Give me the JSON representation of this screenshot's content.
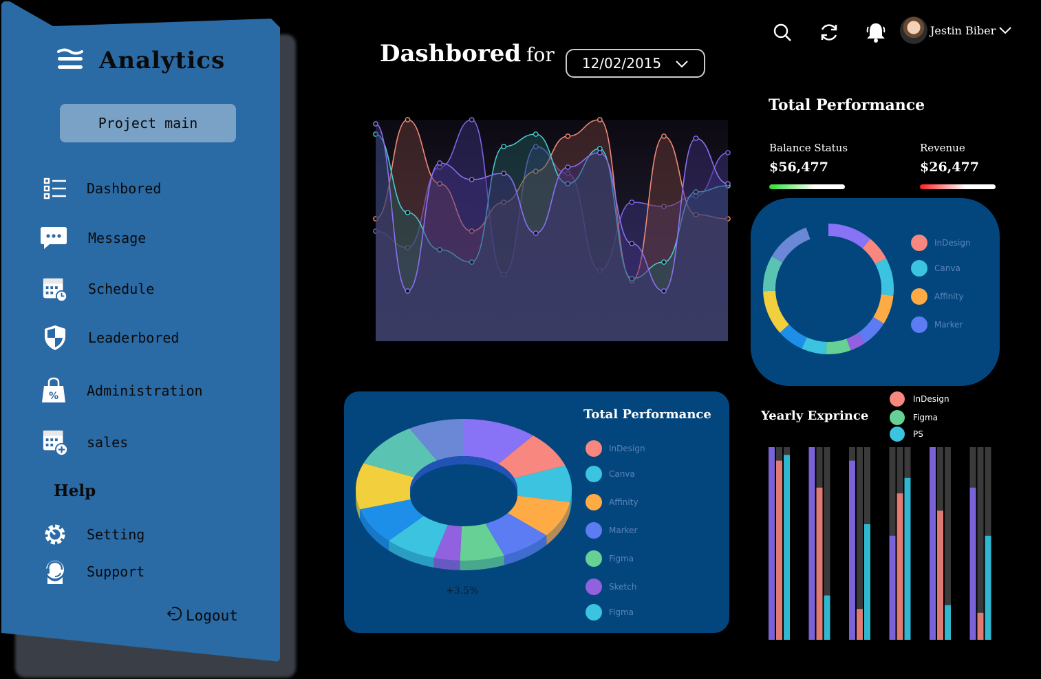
{
  "sidebar": {
    "brand": "Analytics",
    "project_button": "Project main",
    "items": [
      {
        "label": "Dashbored",
        "icon": "list-icon"
      },
      {
        "label": "Message",
        "icon": "message-icon"
      },
      {
        "label": "Schedule",
        "icon": "calendar-clock-icon"
      },
      {
        "label": "Leaderbored",
        "icon": "shield-icon"
      },
      {
        "label": "Administration",
        "icon": "shopping-bag-icon"
      },
      {
        "label": "sales",
        "icon": "calendar-plus-icon"
      }
    ],
    "help_heading": "Help",
    "help_items": [
      {
        "label": "Setting",
        "icon": "gear-icon"
      },
      {
        "label": "Support",
        "icon": "support-icon"
      }
    ],
    "logout": "Logout"
  },
  "header": {
    "title": "Dashbored",
    "title_suffix": "for",
    "date": "12/02/2015",
    "user_name": "Jestin Biber"
  },
  "summary": {
    "title": "Total Performance",
    "balance_label": "Balance Status",
    "balance_value": "$56,477",
    "revenue_label": "Revenue",
    "revenue_value": "$26,477"
  },
  "donut_legend": [
    "InDesign",
    "Canva",
    "Affinity",
    "Marker"
  ],
  "pie": {
    "title": "Total Performance",
    "note": "+3.5%",
    "legend": [
      "InDesign",
      "Canva",
      "Affinity",
      "Marker",
      "Figma",
      "Sketch",
      "Figma"
    ]
  },
  "yearly": {
    "title": "Yearly Exprince",
    "legend": [
      "InDesign",
      "Figma",
      "PS"
    ]
  },
  "colors": {
    "sidebar": "#2a6aa5",
    "card": "#03467e",
    "salmon": "#f8877f",
    "cyan": "#3bc3e0",
    "orange": "#ffab45",
    "blue": "#5b7cf2",
    "green": "#67d195",
    "purple": "#9161e0"
  },
  "chart_data": {
    "type": "area",
    "x": [
      0,
      1,
      2,
      3,
      4,
      5,
      6,
      7,
      8,
      9,
      10,
      11
    ],
    "series": [
      {
        "values": [
          46,
          38,
          77,
          100,
          25,
          87,
          74,
          27,
          60,
          58,
          63,
          84
        ]
      },
      {
        "values": [
          52,
          100,
          69,
          46,
          60,
          75,
          92,
          100,
          22,
          92,
          54,
          52
        ]
      },
      {
        "values": [
          93,
          55,
          37,
          31,
          87,
          93,
          69,
          86,
          23,
          31,
          65,
          68
        ]
      },
      {
        "values": [
          98,
          17,
          79,
          71,
          74,
          45,
          77,
          84,
          40,
          17,
          91,
          69
        ]
      }
    ]
  }
}
